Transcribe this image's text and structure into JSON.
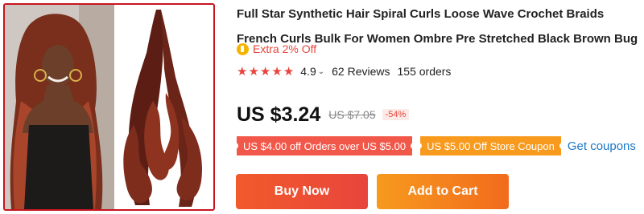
{
  "product": {
    "title_line1": "Full Star Synthetic Hair Spiral Curls Loose Wave Crochet Braids",
    "title_line2": "French Curls Bulk For Women Ombre Pre Stretched Black Brown Bug",
    "extra_offer": "Extra 2% Off",
    "rating": "4.9",
    "stars": 5,
    "reviews": "62 Reviews",
    "orders": "155 orders",
    "price": "US $3.24",
    "old_price": "US $7.05",
    "discount": "-54%"
  },
  "coupons": {
    "store_coupon_1": "US $4.00 off Orders over US $5.00",
    "store_coupon_2": "US $5.00 Off Store Coupon",
    "get_coupons": "Get coupons"
  },
  "actions": {
    "buy_now": "Buy Now",
    "add_to_cart": "Add to Cart"
  },
  "colors": {
    "accent_red": "#e8453c",
    "coupon_red": "#f2584a",
    "coupon_orange": "#f79a1e",
    "link_blue": "#1a77c9",
    "frame_red": "#c8141e"
  }
}
